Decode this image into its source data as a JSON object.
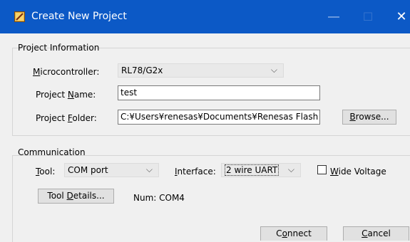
{
  "window": {
    "title": "Create New Project",
    "controls": {
      "minimize": "—",
      "maximize": "☐",
      "close": "✕"
    }
  },
  "project_info": {
    "group_title": "Project Information",
    "microcontroller": {
      "label_u": "M",
      "label_rest": "icrocontroller:",
      "value": "RL78/G2x"
    },
    "project_name": {
      "label_pre": "Project ",
      "label_u": "N",
      "label_rest": "ame:",
      "value": "test"
    },
    "project_folder": {
      "label_pre": "Project ",
      "label_u": "F",
      "label_rest": "older:",
      "value": "C:¥Users¥renesas¥Documents¥Renesas Flash"
    },
    "browse": {
      "label_u": "B",
      "label_rest": "rowse..."
    }
  },
  "communication": {
    "group_title": "Communication",
    "tool": {
      "label_u": "T",
      "label_rest": "ool:",
      "value": "COM port"
    },
    "interface": {
      "label_u": "I",
      "label_rest": "nterface:",
      "value": "2 wire UART"
    },
    "wide_voltage": {
      "label_u": "W",
      "label_rest": "ide Voltage",
      "checked": false
    },
    "tool_details": {
      "label_pre": "Tool ",
      "label_u": "D",
      "label_rest": "etails..."
    },
    "num": "Num: COM4"
  },
  "footer": {
    "connect": {
      "label_pre": "C",
      "label_u": "o",
      "label_rest": "nnect"
    },
    "cancel": {
      "label_u": "C",
      "label_rest": "ancel"
    }
  },
  "colors": {
    "titlebar": "#0c59c6",
    "dialog_bg": "#f0f0f0"
  },
  "icons": {
    "app": "app-icon",
    "chevron": "chevron-down-icon"
  }
}
